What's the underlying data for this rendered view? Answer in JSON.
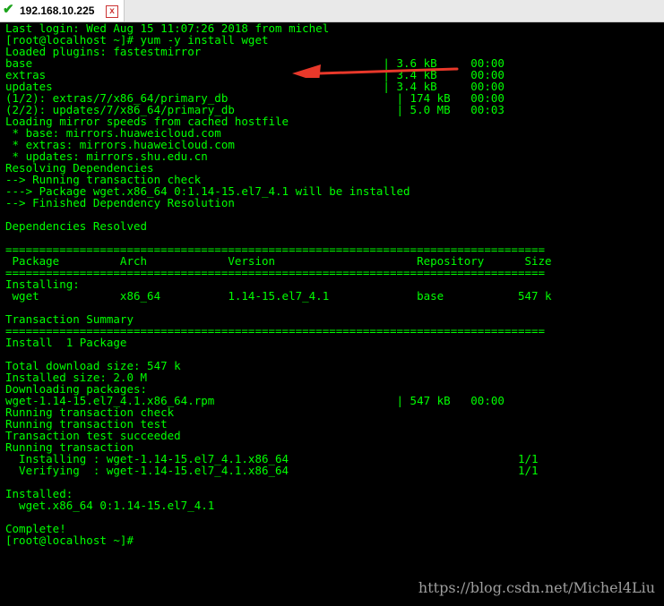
{
  "tab": {
    "title": "192.168.10.225",
    "close_label": "x",
    "status_icon": "check-icon",
    "close_icon": "close-icon"
  },
  "terminal": {
    "lines": [
      "Last login: Wed Aug 15 11:07:26 2018 from michel",
      "[root@localhost ~]# yum -y install wget",
      "Loaded plugins: fastestmirror",
      "base                                                    | 3.6 kB     00:00",
      "extras                                                  | 3.4 kB     00:00",
      "updates                                                 | 3.4 kB     00:00",
      "(1/2): extras/7/x86_64/primary_db                         | 174 kB   00:00",
      "(2/2): updates/7/x86_64/primary_db                        | 5.0 MB   00:03",
      "Loading mirror speeds from cached hostfile",
      " * base: mirrors.huaweicloud.com",
      " * extras: mirrors.huaweicloud.com",
      " * updates: mirrors.shu.edu.cn",
      "Resolving Dependencies",
      "--> Running transaction check",
      "---> Package wget.x86_64 0:1.14-15.el7_4.1 will be installed",
      "--> Finished Dependency Resolution",
      "",
      "Dependencies Resolved",
      "",
      "================================================================================",
      " Package         Arch            Version                     Repository      Size",
      "================================================================================",
      "Installing:",
      " wget            x86_64          1.14-15.el7_4.1             base           547 k",
      "",
      "Transaction Summary",
      "================================================================================",
      "Install  1 Package",
      "",
      "Total download size: 547 k",
      "Installed size: 2.0 M",
      "Downloading packages:",
      "wget-1.14-15.el7_4.1.x86_64.rpm                           | 547 kB   00:00",
      "Running transaction check",
      "Running transaction test",
      "Transaction test succeeded",
      "Running transaction",
      "  Installing : wget-1.14-15.el7_4.1.x86_64                                  1/1",
      "  Verifying  : wget-1.14-15.el7_4.1.x86_64                                  1/1",
      "",
      "Installed:",
      "  wget.x86_64 0:1.14-15.el7_4.1",
      "",
      "Complete!",
      "[root@localhost ~]#"
    ]
  },
  "watermark": "https://blog.csdn.net/Michel4Liu",
  "colors": {
    "terminal_bg": "#000000",
    "terminal_fg": "#00ff00",
    "arrow": "#e8382a",
    "watermark": "#9e9e9e"
  }
}
